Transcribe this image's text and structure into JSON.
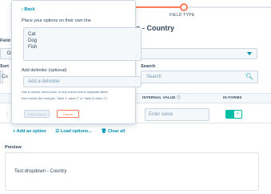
{
  "steps": {
    "current_label": "FIELD TYPE"
  },
  "field": {
    "title_fragment": "n - Country",
    "label_fragment": "Field",
    "select_fragment": "Dr",
    "sort_label_fragment": "Sort",
    "sort_value_fragment": "Cu",
    "search_label": "Search",
    "search_placeholder": "Search"
  },
  "table": {
    "headers": [
      "INTERNAL VALUE",
      "IN FORMS"
    ],
    "internal_value_placeholder": "Enter value",
    "in_forms_enabled": true
  },
  "actions": {
    "add_option": "Add an option",
    "load_options": "Load options...",
    "clear_all": "Clear all"
  },
  "preview": {
    "label": "Preview",
    "text": "Test dropdown - Country"
  },
  "popover": {
    "back": "Back",
    "options_label": "Place your options on their own line",
    "options": [
      "Cat",
      "Dog",
      "Fish"
    ],
    "delimiter_label": "Add delimiter (optional)",
    "delimiter_placeholder": "Add a delimiter",
    "help_line1": "Use a comma, semi-colon, or any custom text to separate labels",
    "help_line2": "from values (for example, \"label 1, value 1\" or \"label 2| value 2\")",
    "load_button": "Load options",
    "cancel_button": "Cancel"
  },
  "colors": {
    "accent": "#0091ae",
    "orange": "#ff7a59",
    "toggle": "#00bda5"
  }
}
